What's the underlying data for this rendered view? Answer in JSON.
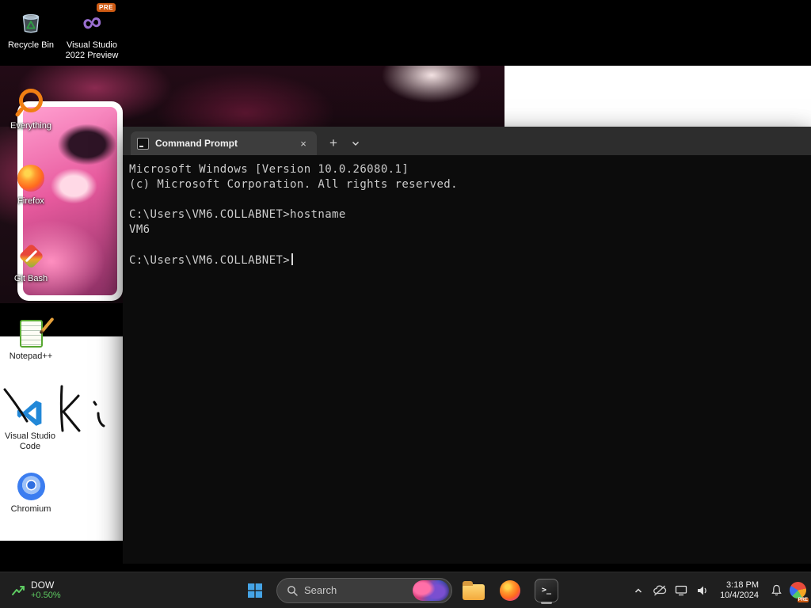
{
  "desktop": {
    "icons": [
      {
        "label": "Recycle Bin"
      },
      {
        "label": "Visual Studio 2022 Preview",
        "badge": "PRE"
      },
      {
        "label": "Everything"
      },
      {
        "label": "Firefox"
      },
      {
        "label": "Git Bash"
      },
      {
        "label": "Notepad++"
      },
      {
        "label": "Visual Studio Code"
      },
      {
        "label": "Chromium"
      }
    ]
  },
  "terminal_window": {
    "tab_title": "Command Prompt",
    "close_tab_label": "×",
    "new_tab_label": "+",
    "lines": [
      "Microsoft Windows [Version 10.0.26080.1]",
      "(c) Microsoft Corporation. All rights reserved.",
      "",
      "C:\\Users\\VM6.COLLABNET>hostname",
      "VM6",
      "",
      "C:\\Users\\VM6.COLLABNET>"
    ]
  },
  "taskbar": {
    "widget": {
      "ticker": "DOW",
      "change": "+0.50%"
    },
    "search": {
      "placeholder": "Search"
    },
    "clock": {
      "time": "3:18 PM",
      "date": "10/4/2024"
    },
    "tray": {
      "app_badge": "PRE"
    }
  },
  "colors": {
    "terminal_bg": "#0c0c0c",
    "taskbar_bg": "#1f1f1f",
    "accent_green": "#5ecc62",
    "vs_purple": "#9a6fd0",
    "everything_orange": "#f07f13"
  }
}
